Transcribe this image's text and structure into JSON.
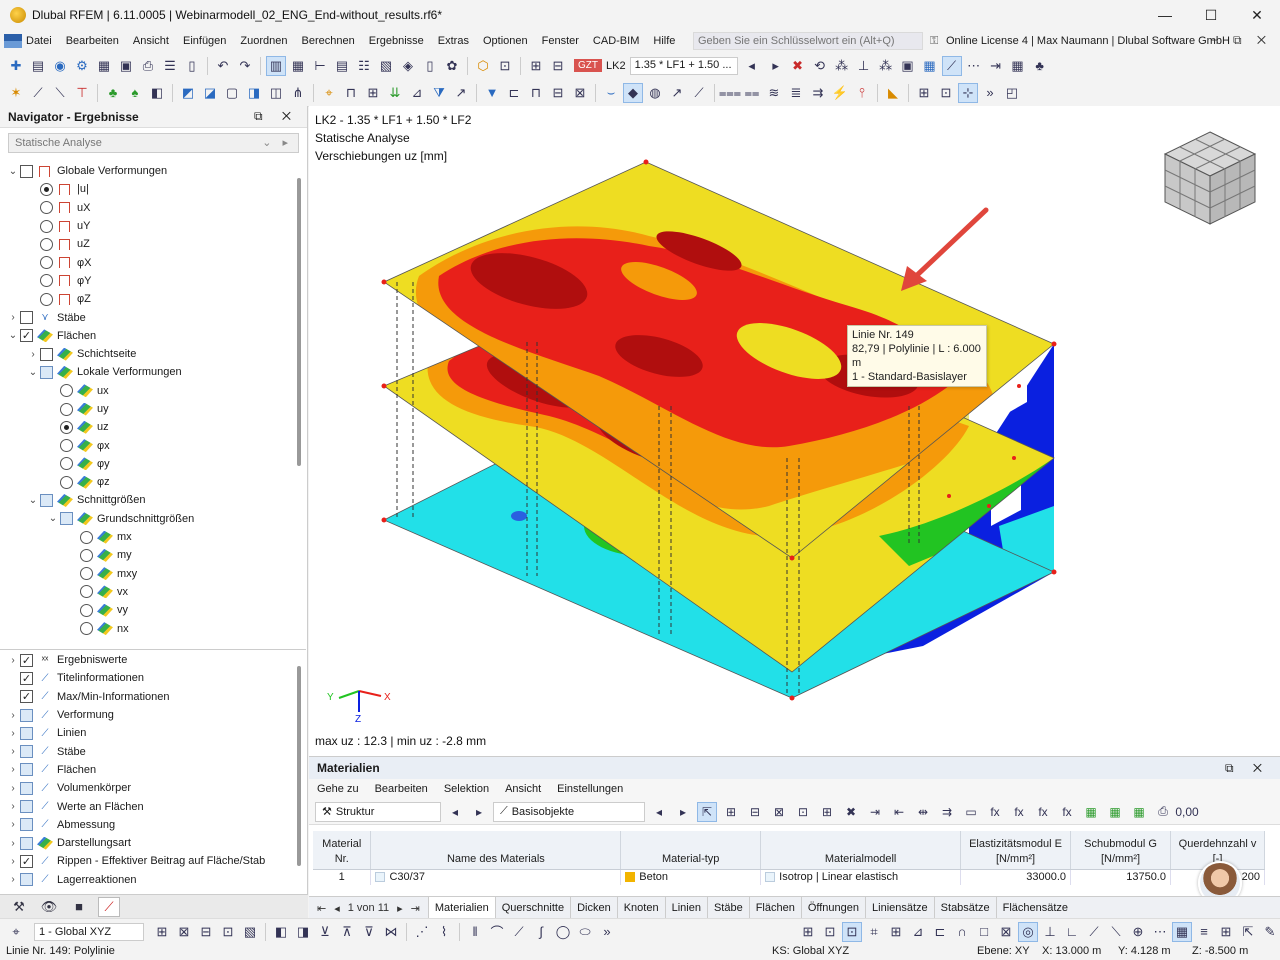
{
  "window": {
    "title": "Dlubal RFEM | 6.11.0005 | Webinarmodell_02_ENG_End-without_results.rf6*"
  },
  "menu": [
    "Datei",
    "Bearbeiten",
    "Ansicht",
    "Einfügen",
    "Zuordnen",
    "Berechnen",
    "Ergebnisse",
    "Extras",
    "Optionen",
    "Fenster",
    "CAD-BIM",
    "Hilfe"
  ],
  "search": {
    "placeholder": "Geben Sie ein Schlüsselwort ein (Alt+Q)"
  },
  "license": "Online License 4 | Max Naumann | Dlubal Software GmbH",
  "loadcase": {
    "badge": "GZT",
    "code": "LK2",
    "combo": "1.35 * LF1 + 1.50 ..."
  },
  "navigator": {
    "title": "Navigator - Ergebnisse",
    "combo": "Statische Analyse",
    "items": [
      {
        "label": "Globale Verformungen"
      },
      {
        "label": "|u|"
      },
      {
        "label": "uX"
      },
      {
        "label": "uY"
      },
      {
        "label": "uZ"
      },
      {
        "label": "φX"
      },
      {
        "label": "φY"
      },
      {
        "label": "φZ"
      },
      {
        "label": "Stäbe"
      },
      {
        "label": "Flächen"
      },
      {
        "label": "Schichtseite"
      },
      {
        "label": "Lokale Verformungen"
      },
      {
        "label": "ux"
      },
      {
        "label": "uy"
      },
      {
        "label": "uz"
      },
      {
        "label": "φx"
      },
      {
        "label": "φy"
      },
      {
        "label": "φz"
      },
      {
        "label": "Schnittgrößen"
      },
      {
        "label": "Grundschnittgrößen"
      },
      {
        "label": "mx"
      },
      {
        "label": "my"
      },
      {
        "label": "mxy"
      },
      {
        "label": "vx"
      },
      {
        "label": "vy"
      },
      {
        "label": "nx"
      }
    ],
    "items2": [
      {
        "label": "Ergebniswerte"
      },
      {
        "label": "Titelinformationen"
      },
      {
        "label": "Max/Min-Informationen"
      },
      {
        "label": "Verformung"
      },
      {
        "label": "Linien"
      },
      {
        "label": "Stäbe"
      },
      {
        "label": "Flächen"
      },
      {
        "label": "Volumenkörper"
      },
      {
        "label": "Werte an Flächen"
      },
      {
        "label": "Abmessung"
      },
      {
        "label": "Darstellungsart"
      },
      {
        "label": "Rippen - Effektiver Beitrag auf Fläche/Stab"
      },
      {
        "label": "Lagerreaktionen"
      }
    ]
  },
  "viewport": {
    "line1": "LK2 - 1.35 * LF1 + 1.50 * LF2",
    "line2": "Statische Analyse",
    "line3": "Verschiebungen uz [mm]",
    "maxmin": "max uz : 12.3 | min uz : -2.8 mm",
    "tooltip": {
      "l1": "Linie Nr. 149",
      "l2": "82,79 | Polylinie | L : 6.000 m",
      "l3": "1 - Standard-Basislayer"
    },
    "axes": {
      "x": "X",
      "y": "Y",
      "z": "Z"
    }
  },
  "panel": {
    "title": "Materialien",
    "menu": [
      "Gehe zu",
      "Bearbeiten",
      "Selektion",
      "Ansicht",
      "Einstellungen"
    ],
    "combo1": "Struktur",
    "combo2": "Basisobjekte",
    "headers": [
      "Material Nr.",
      "Name des Materials",
      "Material-typ",
      "Materialmodell",
      "Elastizitätsmodul E [N/mm²]",
      "Schubmodul G [N/mm²]",
      "Querdehnzahl v [-]"
    ],
    "rows": [
      {
        "nr": "1",
        "name": "C30/37",
        "type": "Beton",
        "model": "Isotrop | Linear elastisch",
        "e": "33000.0",
        "g": "13750.0",
        "v": "200"
      }
    ],
    "pager": "1 von 11",
    "tabs": [
      "Materialien",
      "Querschnitte",
      "Dicken",
      "Knoten",
      "Linien",
      "Stäbe",
      "Flächen",
      "Öffnungen",
      "Liniensätze",
      "Stabsätze",
      "Flächensätze"
    ]
  },
  "bottom": {
    "combo": "1 - Global XYZ"
  },
  "status": {
    "left": "Linie Nr. 149: Polylinie",
    "ks": "KS: Global XYZ",
    "ebene": "Ebene: XY",
    "x": "X: 13.000 m",
    "y": "Y: 4.128 m",
    "z": "Z: -8.500 m"
  },
  "colors": {
    "red": "#e8201a",
    "darkred": "#b00e0e",
    "orange": "#f59a0a",
    "yellow": "#eedd22",
    "green": "#22c422",
    "cyan": "#22e0e8",
    "blue": "#0a20e0"
  }
}
